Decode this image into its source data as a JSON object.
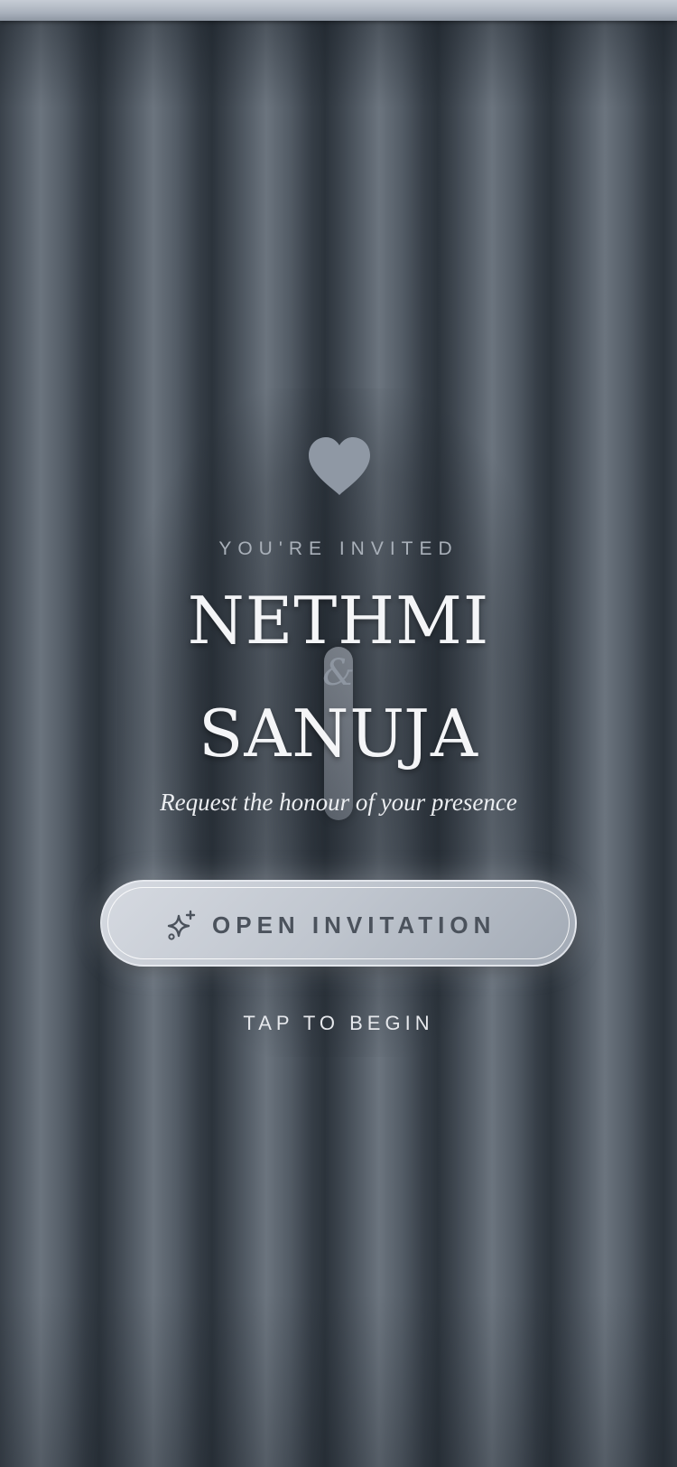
{
  "invite": {
    "eyebrow": "YOU'RE INVITED",
    "name_one": "NETHMI",
    "ampersand": "&",
    "name_two": "SANUJA",
    "subtitle": "Request the honour of your presence"
  },
  "cta": {
    "label": "OPEN INVITATION",
    "icon": "sparkle-icon",
    "hint": "TAP TO BEGIN"
  },
  "decor": {
    "top_icon": "heart-icon"
  },
  "colors": {
    "curtain": "#3c4550",
    "curtain_highlight": "#6b747e",
    "heart": "#8f98a4",
    "button": "#c3c9d1",
    "button_text": "#4b525c",
    "text": "#f4f5f7"
  }
}
